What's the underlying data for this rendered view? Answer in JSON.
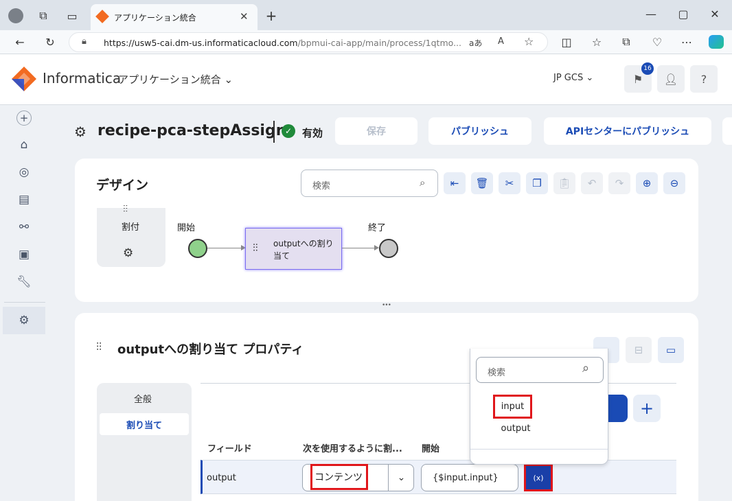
{
  "browser": {
    "tab_title": "アプリケーション統合",
    "url_host": "https://usw5-cai.dm-us.informaticacloud.com",
    "url_path": "/bpmui-cai-app/main/process/1qtmo...",
    "reader_label": "aあ"
  },
  "header": {
    "brand": "Informatica",
    "product": "アプリケーション統合",
    "org": "JP GCS",
    "notif_count": "16",
    "help": "?"
  },
  "process": {
    "name": "recipe-pca-stepAssign",
    "status": "有効",
    "save": "保存",
    "publish": "パブリッシュ",
    "publish_api": "APIセンターにパブリッシュ"
  },
  "design": {
    "title": "デザイン",
    "search_placeholder": "検索",
    "palette_label": "割付",
    "start_label": "開始",
    "end_label": "終了",
    "step_label": "outputへの割り当て",
    "handle": "•••"
  },
  "props": {
    "title": "outputへの割り当て プロパティ",
    "tab_general": "全般",
    "tab_assign": "割り当て",
    "col_field": "フィールド",
    "col_use": "次を使用するように割...",
    "col_start": "開始",
    "row_field": "output",
    "row_use": "コンテンツ",
    "row_value": "{$input.input}",
    "row_expr": "(x)"
  },
  "popup": {
    "search_placeholder": "検索",
    "items": [
      "input",
      "output"
    ]
  },
  "colors": {
    "accent": "#1a4bb5",
    "start_node": "#8fd18b",
    "end_node": "#c8c8c8",
    "step_fill": "#e4dff0",
    "highlight": "#e0161b"
  }
}
